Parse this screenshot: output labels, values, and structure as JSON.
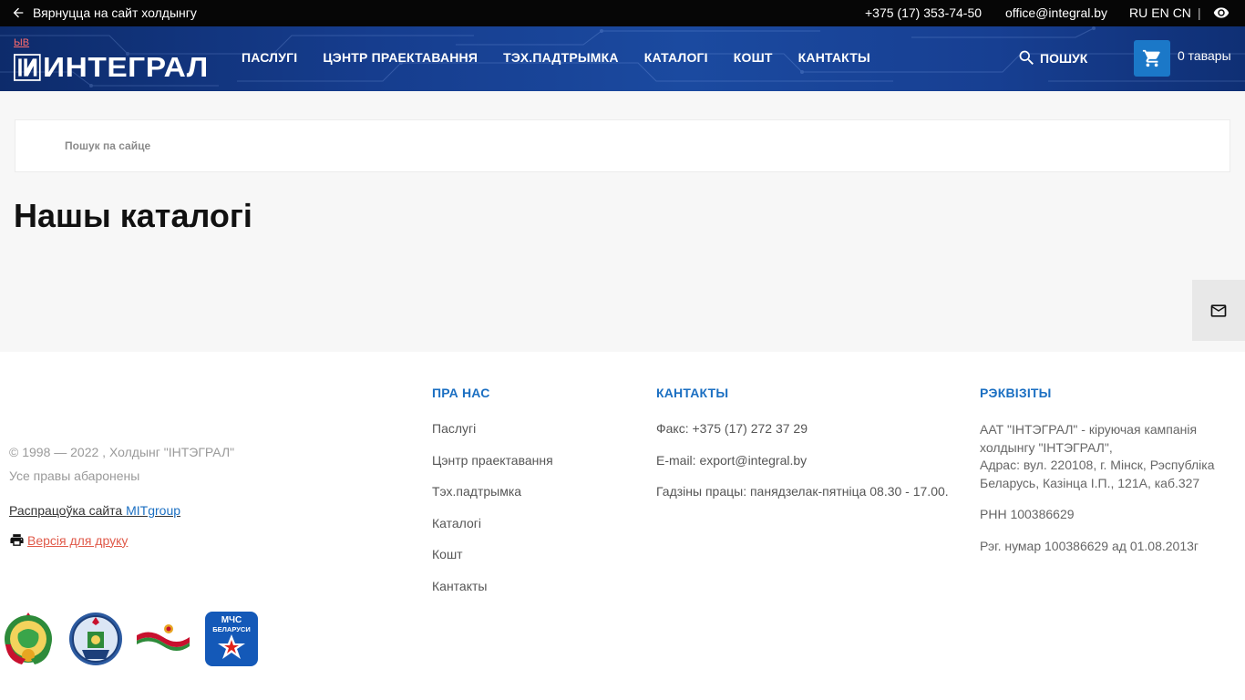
{
  "topbar": {
    "back_label": "Вярнуцца на сайт холдынгу",
    "phone": "+375 (17) 353-74-50",
    "email": "office@integral.by",
    "languages": [
      "RU",
      "EN",
      "CN"
    ],
    "separator": "|",
    "icons": [
      "arrow-left-icon",
      "eye-icon"
    ]
  },
  "header": {
    "ab_label": "ЫВ",
    "logo_text": "ИНТЕГРАЛ",
    "nav": [
      "ПАСЛУГІ",
      "ЦЭНТР ПРАЕКТАВАННЯ",
      "ТЭХ.ПАДТРЫМКА",
      "КАТАЛОГІ",
      "КОШТ",
      "КАНТАКТЫ"
    ],
    "search_label": "ПОШУК",
    "cart_label": "0 тавары",
    "accent": "#1b78c8",
    "icons": [
      "search-icon",
      "cart-icon"
    ]
  },
  "main": {
    "search_placeholder": "Пошук па сайце",
    "title": "Нашы каталогі",
    "feedback_icon": "mail-icon"
  },
  "footer": {
    "copyright": "© 1998 — 2022 , Холдынг \"ІНТЭГРАЛ\"",
    "rights": "Усе правы абаронены",
    "dev_prefix": "Распрацоўка сайта ",
    "dev_link": "MITgroup",
    "print_label": " Версія для друку",
    "about": {
      "title": "ПРА НАС",
      "items": [
        "Паслугі",
        "Цэнтр праектавання",
        "Тэх.падтрымка",
        "Каталогі",
        "Кошт",
        "Кантакты"
      ]
    },
    "contacts": {
      "title": "КАНТАКТЫ",
      "items": [
        "Факс: +375 (17) 272 37 29",
        "E-mail: export@integral.by",
        "Гадзіны працы: панядзелак-пятніца 08.30 - 17.00."
      ]
    },
    "requisites": {
      "title": "РЭКВІЗІТЫ",
      "company": "ААТ \"ІНТЭГРАЛ\" - кіруючая кампанія холдынгу \"ІНТЭГРАЛ\",",
      "address": "Адрас: вул. 220108, г. Мінск, Рэспубліка Беларусь, Казінца І.П., 121А, каб.327",
      "unp": "РНН 100386629",
      "reg": "Рэг. нумар 100386629 ад 01.08.2013г"
    },
    "emblems": [
      "belarus-coat-of-arms",
      "state-emblem-badge",
      "belarus-flag-ribbon",
      "mchs-belarus-logo"
    ],
    "mchs_text_1": "МЧС",
    "mchs_text_2": "БЕЛАРУСИ",
    "link_color": "#1b6fc2"
  }
}
